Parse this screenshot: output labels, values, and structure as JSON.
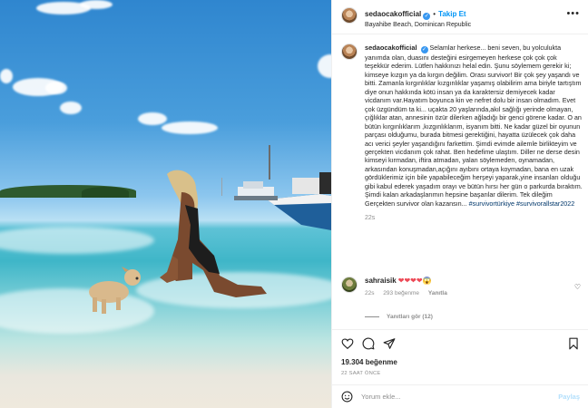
{
  "post": {
    "username": "sedaocakofficial",
    "follow_label": "Takip Et",
    "location": "Bayahibe Beach, Dominican Republic",
    "more_label": "•••"
  },
  "caption": {
    "username": "sedaocakofficial",
    "text": "Selamlar herkese... beni seven, bu yolculukta yanımda olan, duasını desteğini esirgemeyen herkese çok çok çok teşekkür ederim. Lütfen hakkınızı helal edin. Şunu söylemem gerekir ki; kimseye kızgın ya da kırgın değilim. Orası survivor! Bir çok şey yaşandı ve bitti. Zamanla kırgınlıklar kızgınlıklar yaşamış olabilirim ama biriyle tartıştım diye onun hakkında kötü insan ya da karaktersiz demiyecek kadar vicdanım var.Hayatım boyunca kin ve nefret dolu bir insan olmadım. Evet çok üzgündüm ta ki... uçakta 20 yaşlarında,akıl sağlığı yerinde olmayan, çığlıklar atan, annesinin özür dilerken ağladığı bir genci görene kadar. O an bütün kırgınlıklarım ,kızgınlıklarım, isyanım bitti. Ne kadar güzel bir oyunun parçası olduğumu, burada bitmesi gerektiğini, hayatta üzülecek çok daha acı verici şeyler yaşandığını farkettim. Şimdi evimde ailemle birlikteyim ve gerçekten vicdanım çok rahat. Ben hedefime ulaştım. Diller ne derse desin kimseyi kırmadan, iftira atmadan, yalan söylemeden, oynamadan, arkasından konuşmadan,açığını ayıbını ortaya koymadan, bana en uzak gördüklerimiz için bile yapabileceğim herşeyi yaparak,yine insanları olduğu gibi kabul ederek yaşadım orayı ve bütün hırsı her gün o parkurda bıraktım. Şimdi kalan arkadaşlarımın hepsine başarılar dilerim. Tek dileğim Gerçekten survivor olan kazansın... ",
    "hashtag1": "#survivortürkiye",
    "hashtag2": "#survivorallstar2022",
    "time": "22s"
  },
  "comment": {
    "username": "sahraisik",
    "text": "❤❤❤❤",
    "emoji_extra": "😱",
    "time": "22s",
    "likes": "293 beğenme",
    "reply_label": "Yanıtla"
  },
  "replies_label": "Yanıtları gör (12)",
  "actions": {
    "likes": "19.304 beğenme",
    "ago": "22 SAAT ÖNCE"
  },
  "add_comment": {
    "placeholder": "Yorum ekle...",
    "post_label": "Paylaş"
  },
  "colors": {
    "accent": "#0095f6",
    "heart": "#ed4956",
    "muted": "#8e8e8e"
  }
}
